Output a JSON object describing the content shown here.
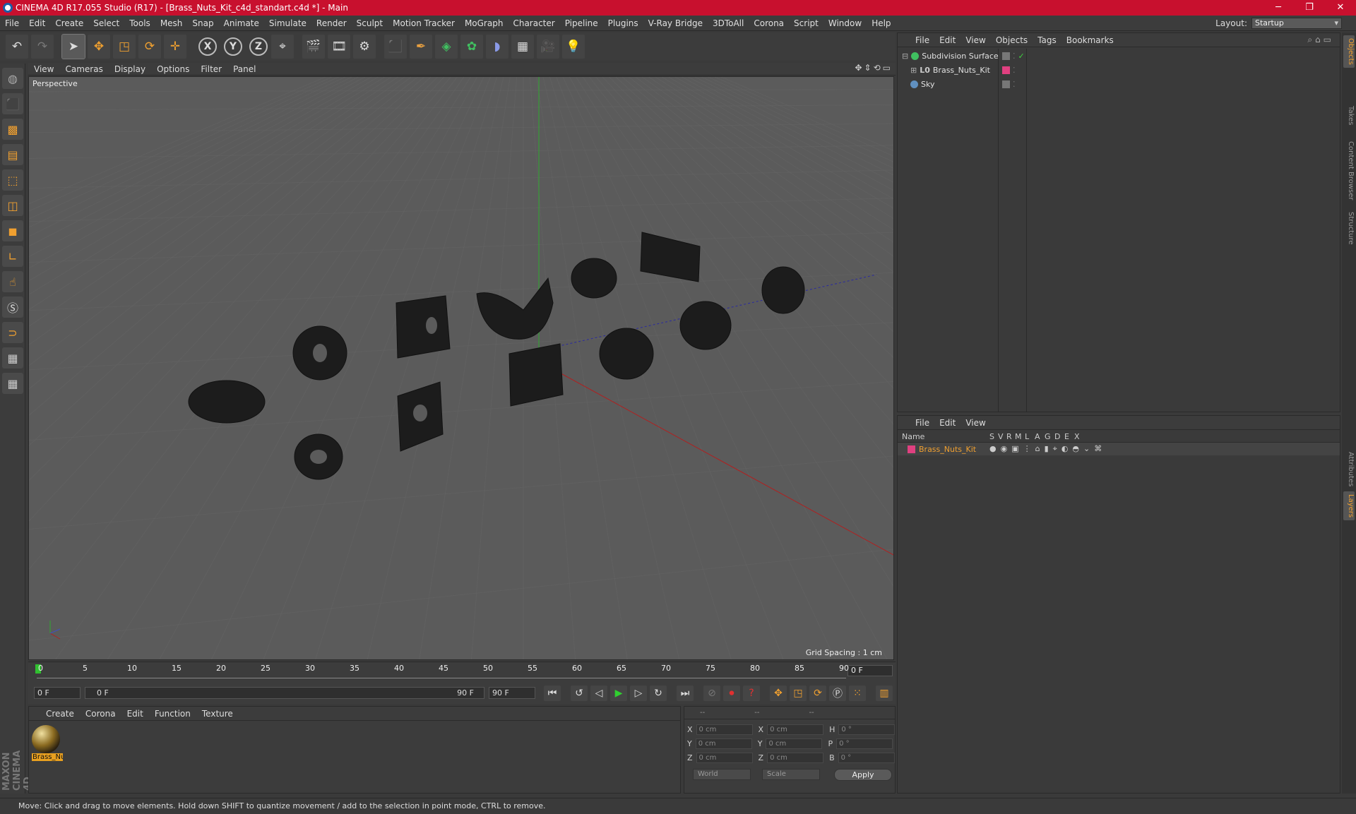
{
  "title": "CINEMA 4D R17.055 Studio (R17) - [Brass_Nuts_Kit_c4d_standart.c4d *] - Main",
  "menu": [
    "File",
    "Edit",
    "Create",
    "Select",
    "Tools",
    "Mesh",
    "Snap",
    "Animate",
    "Simulate",
    "Render",
    "Sculpt",
    "Motion Tracker",
    "MoGraph",
    "Character",
    "Pipeline",
    "Plugins",
    "V-Ray Bridge",
    "3DToAll",
    "Corona",
    "Script",
    "Window",
    "Help"
  ],
  "layout": {
    "label": "Layout:",
    "value": "Startup"
  },
  "viewport": {
    "menu": [
      "View",
      "Cameras",
      "Display",
      "Options",
      "Filter",
      "Panel"
    ],
    "label": "Perspective",
    "grid_spacing": "Grid Spacing : 1 cm"
  },
  "timeline": {
    "ticks": [
      "0",
      "5",
      "10",
      "15",
      "20",
      "25",
      "30",
      "35",
      "40",
      "45",
      "50",
      "55",
      "60",
      "65",
      "70",
      "75",
      "80",
      "85",
      "90"
    ],
    "current_frame": "0 F"
  },
  "transport": {
    "start": "0 F",
    "range_start": "0 F",
    "range_end": "90 F",
    "end": "90 F"
  },
  "material_panel": {
    "menu": [
      "Create",
      "Corona",
      "Edit",
      "Function",
      "Texture"
    ],
    "material_name": "Brass_Nut"
  },
  "coords": {
    "header": [
      "--",
      "--",
      "--"
    ],
    "rows": [
      {
        "a": "X",
        "av": "0 cm",
        "b": "X",
        "bv": "0 cm",
        "c": "H",
        "cv": "0 °"
      },
      {
        "a": "Y",
        "av": "0 cm",
        "b": "Y",
        "bv": "0 cm",
        "c": "P",
        "cv": "0 °"
      },
      {
        "a": "Z",
        "av": "0 cm",
        "b": "Z",
        "bv": "0 cm",
        "c": "B",
        "cv": "0 °"
      }
    ],
    "mode": "World",
    "type": "Scale",
    "apply": "Apply"
  },
  "status": "Move: Click and drag to move elements. Hold down SHIFT to quantize movement / add to the selection in point mode, CTRL to remove.",
  "objects_panel": {
    "menu": [
      "File",
      "Edit",
      "View",
      "Objects",
      "Tags",
      "Bookmarks"
    ],
    "items": [
      {
        "name": "Subdivision Surface",
        "color": "#40c060"
      },
      {
        "name": "Brass_Nuts_Kit",
        "color": "#e04080"
      },
      {
        "name": "Sky",
        "color": "#6090c0"
      }
    ]
  },
  "layers_panel": {
    "menu": [
      "File",
      "Edit",
      "View"
    ],
    "columns": [
      "Name",
      "S",
      "V",
      "R",
      "M",
      "L",
      "A",
      "G",
      "D",
      "E",
      "X"
    ],
    "layer": {
      "name": "Brass_Nuts_Kit",
      "color": "#e04080"
    }
  },
  "right_tabs": [
    "Objects",
    "Takes",
    "Content Browser",
    "Structure",
    "Attributes",
    "Layers"
  ],
  "maxon": "MAXON CINEMA 4D"
}
